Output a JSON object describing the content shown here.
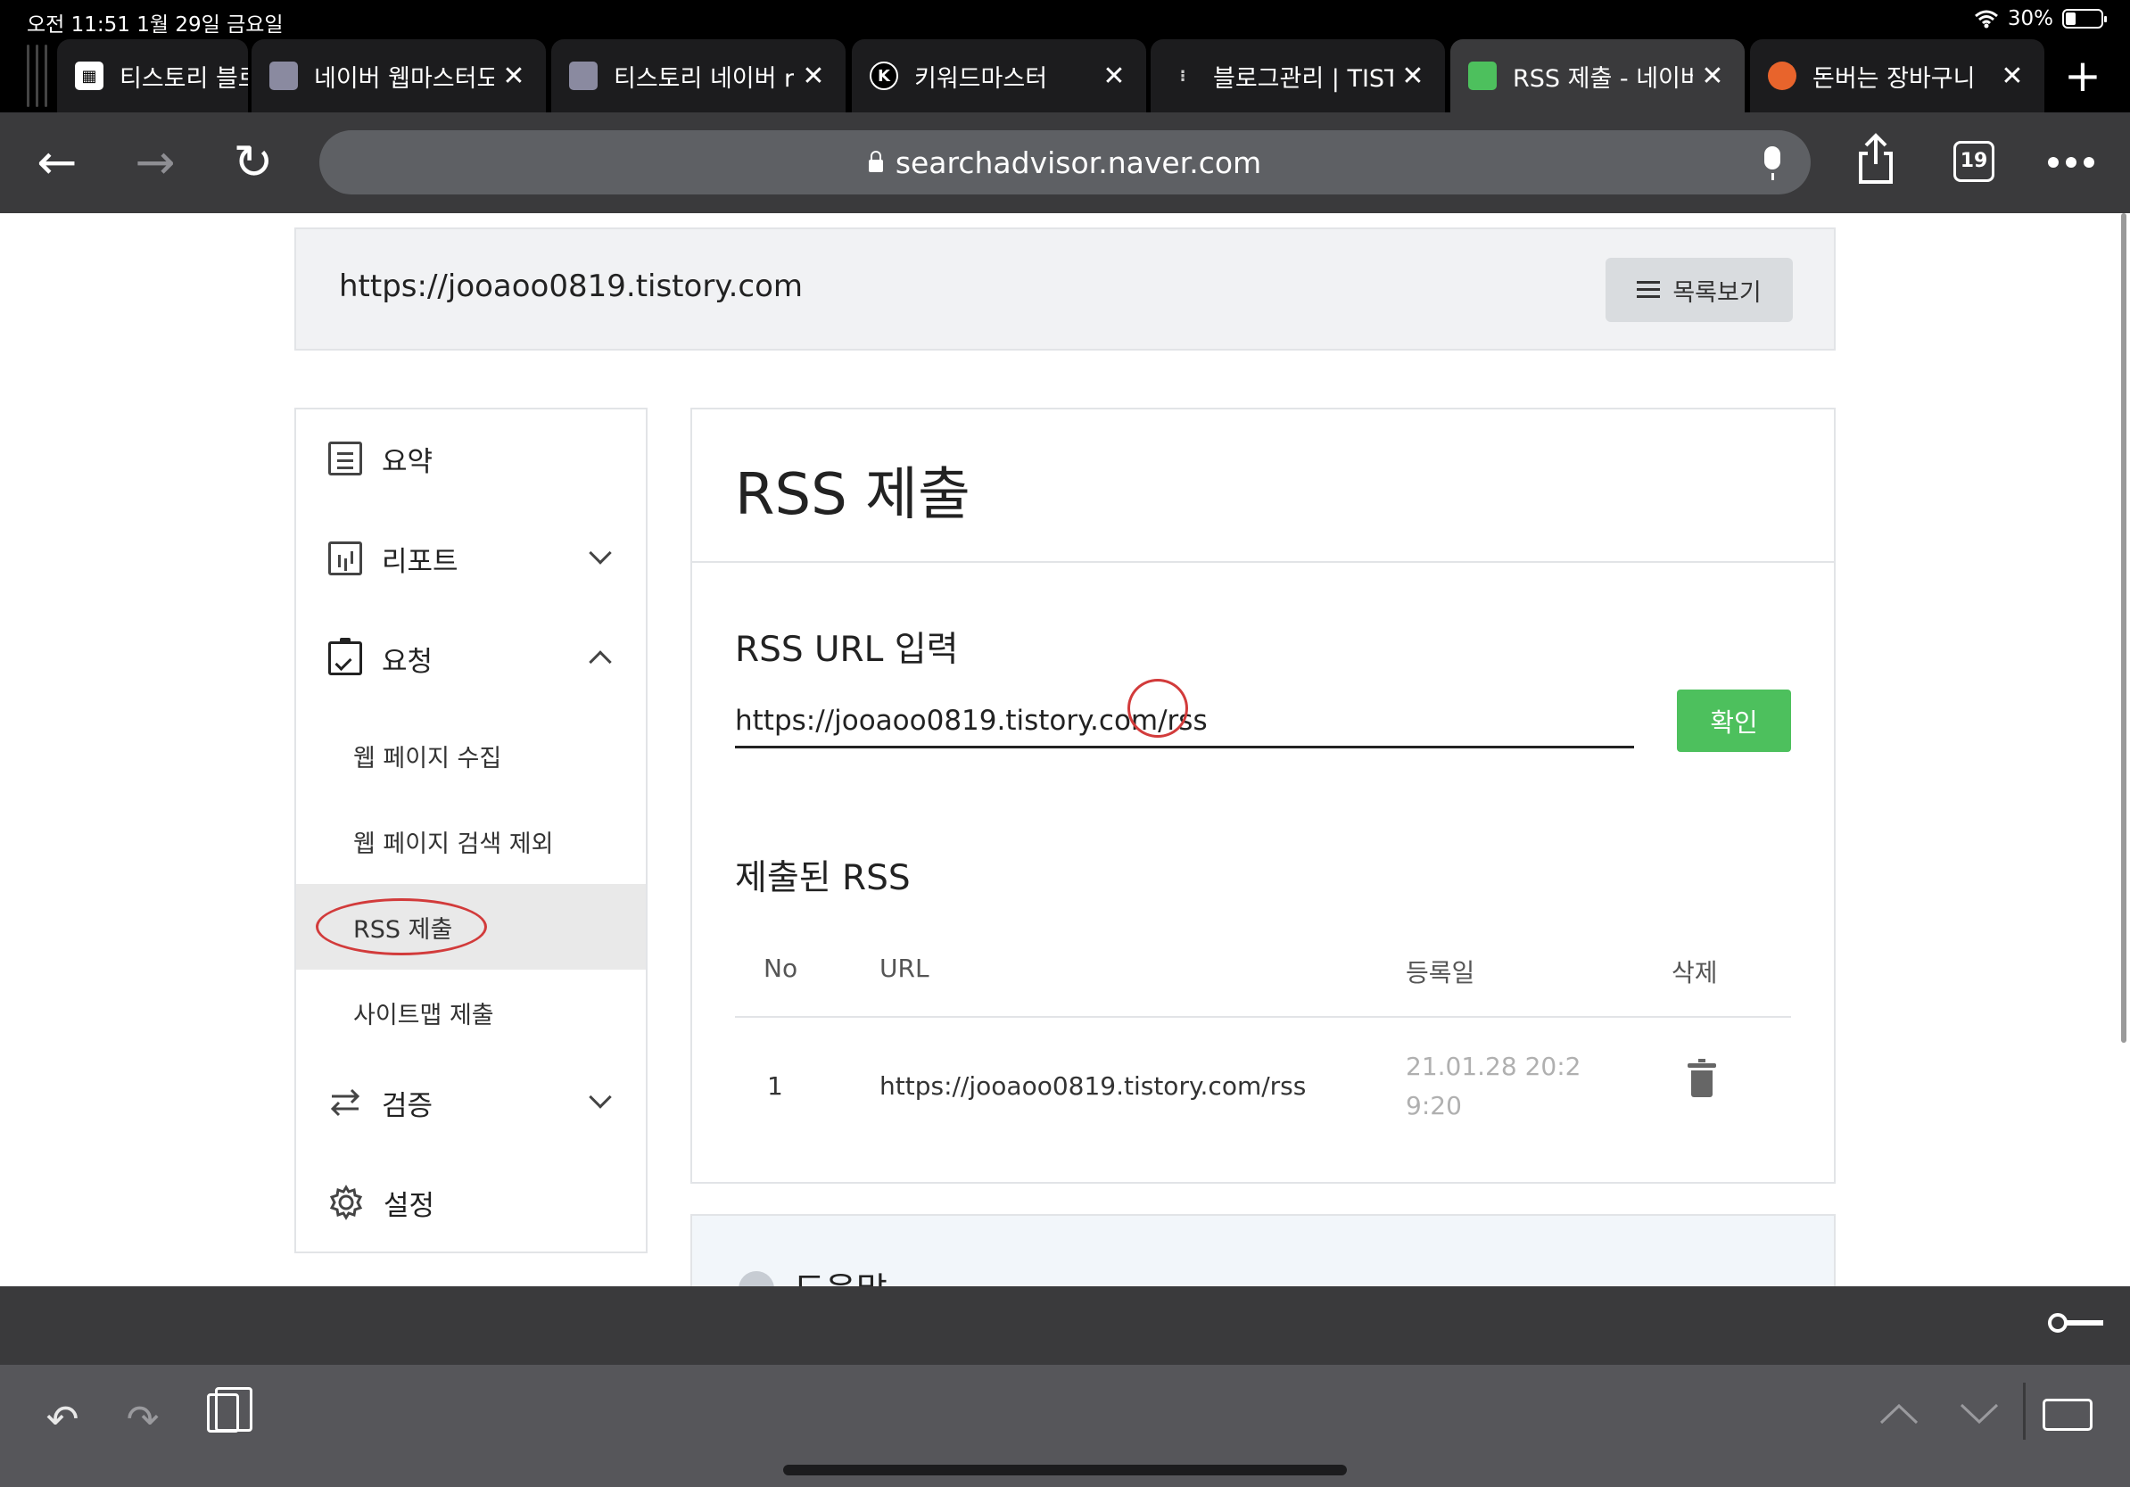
{
  "status_bar": {
    "time": "오전 11:51  1월 29일 금요일",
    "wifi": "wifi",
    "battery": "30%"
  },
  "tabs": [
    {
      "title": "티스토리 블로",
      "favicon": "tistory-icon",
      "active": false
    },
    {
      "title": "네이버 웹마스터도",
      "favicon": "profile-icon",
      "active": false
    },
    {
      "title": "티스토리 네이버 r",
      "favicon": "profile-icon",
      "active": false
    },
    {
      "title": "키워드마스터",
      "favicon": "K",
      "active": false
    },
    {
      "title": "블로그관리 | TIST",
      "favicon": "tistory-dots-icon",
      "active": false
    },
    {
      "title": "RSS 제출 - 네이버",
      "favicon": "searchadvisor-icon",
      "active": true
    },
    {
      "title": "돈버는 장바구니",
      "favicon": "orange-icon",
      "active": false
    }
  ],
  "toolbar": {
    "url": "searchadvisor.naver.com",
    "tab_count": "19"
  },
  "site_bar": {
    "site_url": "https://jooaoo0819.tistory.com",
    "list_button": "목록보기"
  },
  "sidebar": {
    "summary": "요약",
    "report": "리포트",
    "request": "요청",
    "request_sub": [
      "웹 페이지 수집",
      "웹 페이지 검색 제외",
      "RSS 제출",
      "사이트맵 제출"
    ],
    "verify": "검증",
    "settings": "설정"
  },
  "main": {
    "title": "RSS 제출",
    "input_label": "RSS URL 입력",
    "input_value": "https://jooaoo0819.tistory.com/rss",
    "confirm_button": "확인",
    "submitted_label": "제출된 RSS",
    "table": {
      "headers": [
        "No",
        "URL",
        "등록일",
        "삭제"
      ],
      "rows": [
        {
          "no": "1",
          "url": "https://jooaoo0819.tistory.com/rss",
          "date": "21.01.28 20:29:20"
        }
      ]
    }
  },
  "help": {
    "title": "도움말"
  },
  "keyboard_toolbar": {
    "undo": "↶",
    "redo": "↷"
  }
}
